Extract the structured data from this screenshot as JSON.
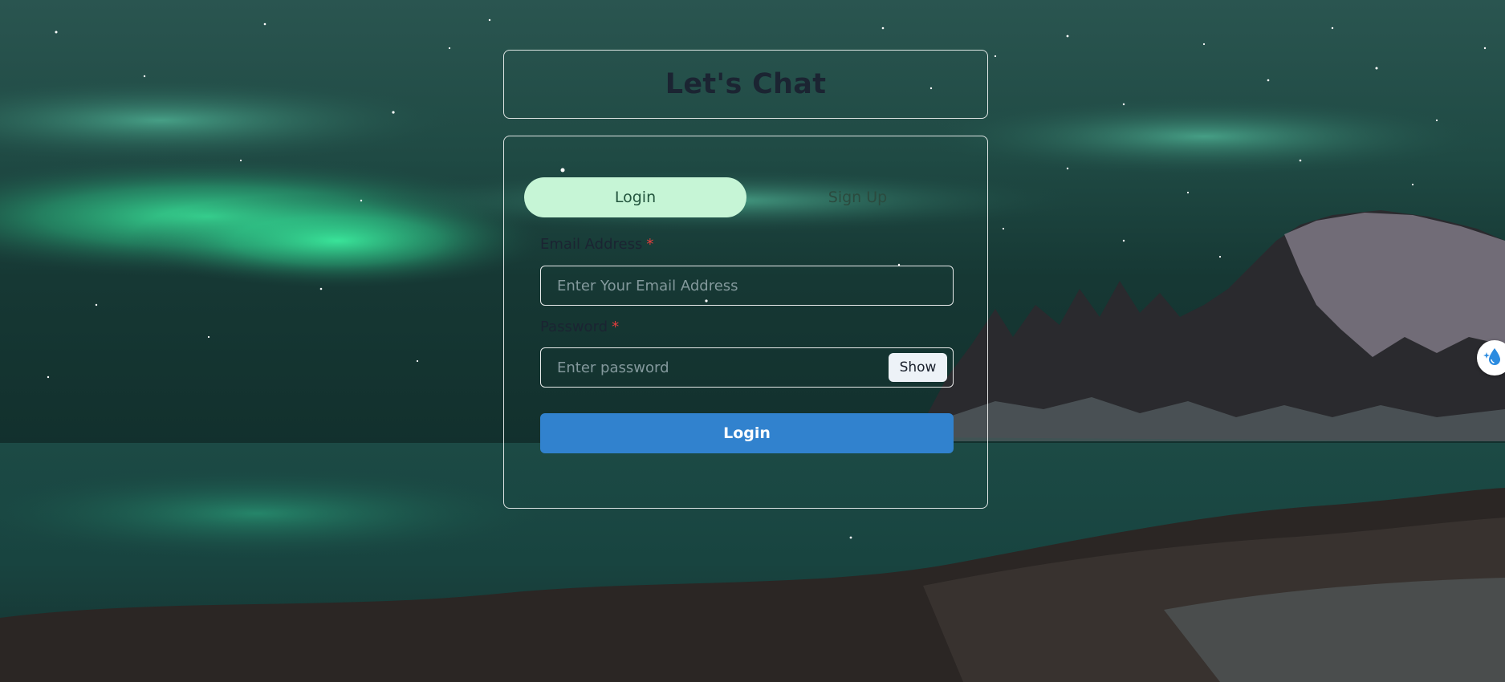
{
  "header": {
    "title": "Let's Chat"
  },
  "tabs": [
    {
      "label": "Login",
      "active": true
    },
    {
      "label": "Sign Up",
      "active": false
    }
  ],
  "form": {
    "email": {
      "label": "Email Address",
      "required_mark": "*",
      "placeholder": "Enter Your Email Address",
      "value": ""
    },
    "password": {
      "label": "Password",
      "required_mark": "*",
      "placeholder": "Enter password",
      "value": "",
      "toggle_label": "Show"
    },
    "submit_label": "Login"
  },
  "background": {
    "icon": "aurora-landscape-background"
  },
  "extension": {
    "icon": "water-drop-sparkle-icon"
  },
  "colors": {
    "accent": "#3182ce",
    "active_tab": "#c6f5d6",
    "required": "#e53e3e",
    "title_text": "#1b2432"
  }
}
